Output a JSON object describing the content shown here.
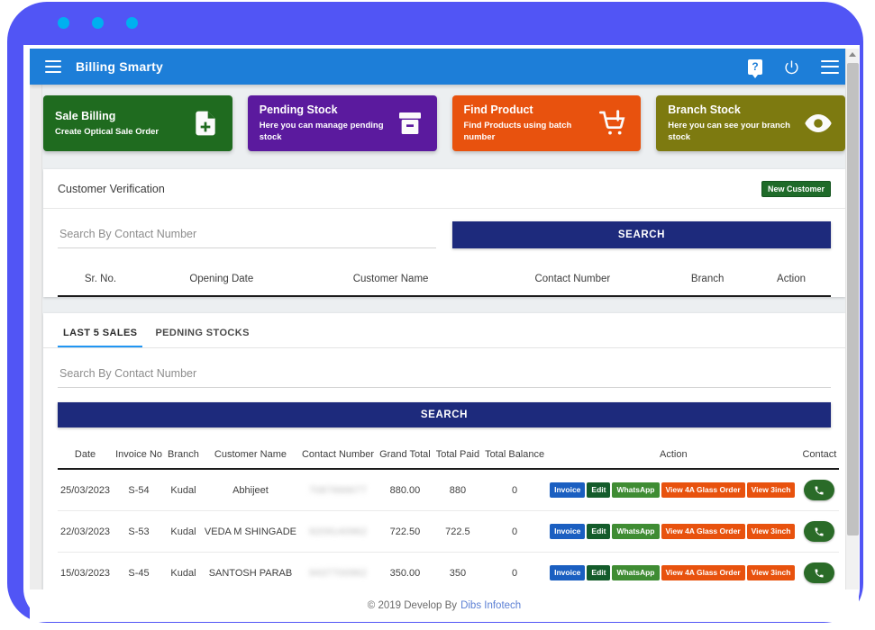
{
  "window": {
    "dots": [
      "dot-1",
      "dot-2",
      "dot-3"
    ]
  },
  "header": {
    "title": "Billing Smarty",
    "menu_icon": "hamburger-icon",
    "help_icon": "help-question-icon",
    "help_label": "?",
    "power_icon": "power-icon",
    "right_menu_icon": "hamburger-icon"
  },
  "cards": [
    {
      "title": "Sale Billing",
      "subtitle": "Create Optical Sale Order",
      "color": "#1f6b1f",
      "icon": "file-plus-icon"
    },
    {
      "title": "Pending Stock",
      "subtitle": "Here you can manage pending stock",
      "color": "#5b1a9e",
      "icon": "archive-box-icon"
    },
    {
      "title": "Find Product",
      "subtitle": "Find Products using batch number",
      "color": "#e8520e",
      "icon": "cart-alert-icon"
    },
    {
      "title": "Branch Stock",
      "subtitle": "Here you can see your branch stock",
      "color": "#7d7a10",
      "icon": "eye-icon"
    }
  ],
  "customer_verification": {
    "panel_label": "Customer Verification",
    "new_customer_label": "New Customer",
    "search_placeholder": "Search By Contact Number",
    "search_value": "",
    "search_button_label": "SEARCH",
    "columns": [
      "Sr. No.",
      "Opening Date",
      "Customer Name",
      "Contact Number",
      "Branch",
      "Action"
    ],
    "rows": []
  },
  "sales_panel": {
    "tabs": [
      {
        "label": "LAST 5 SALES",
        "active": true
      },
      {
        "label": "PEDNING STOCKS",
        "active": false
      }
    ],
    "search_placeholder": "Search By Contact Number",
    "search_value": "",
    "search_button_label": "SEARCH",
    "columns": [
      "Date",
      "Invoice No",
      "Branch",
      "Customer Name",
      "Contact Number",
      "Grand Total",
      "Total Paid",
      "Total Balance",
      "Action",
      "Contact"
    ],
    "action_buttons": [
      {
        "label": "Invoice",
        "color": "#1b5fc1"
      },
      {
        "label": "Edit",
        "color": "#145c2b"
      },
      {
        "label": "WhatsApp",
        "color": "#3f8c33"
      },
      {
        "label": "View 4A Glass Order",
        "color": "#e8520e"
      },
      {
        "label": "View 3inch",
        "color": "#e8520e"
      }
    ],
    "contact_icon": "phone-icon",
    "rows": [
      {
        "date": "25/03/2023",
        "invoice_no": "S-54",
        "branch": "Kudal",
        "customer_name": "Abhijeet",
        "contact_number": "7087666677",
        "grand_total": "880.00",
        "total_paid": "880",
        "total_balance": "0"
      },
      {
        "date": "22/03/2023",
        "invoice_no": "S-53",
        "branch": "Kudal",
        "customer_name": "VEDA M SHINGADE",
        "contact_number": "9209140962",
        "grand_total": "722.50",
        "total_paid": "722.5",
        "total_balance": "0"
      },
      {
        "date": "15/03/2023",
        "invoice_no": "S-45",
        "branch": "Kudal",
        "customer_name": "SANTOSH PARAB",
        "contact_number": "9437700962",
        "grand_total": "350.00",
        "total_paid": "350",
        "total_balance": "0"
      }
    ]
  },
  "footer": {
    "text": "© 2019 Develop By",
    "link_label": "Dibs Infotech"
  }
}
